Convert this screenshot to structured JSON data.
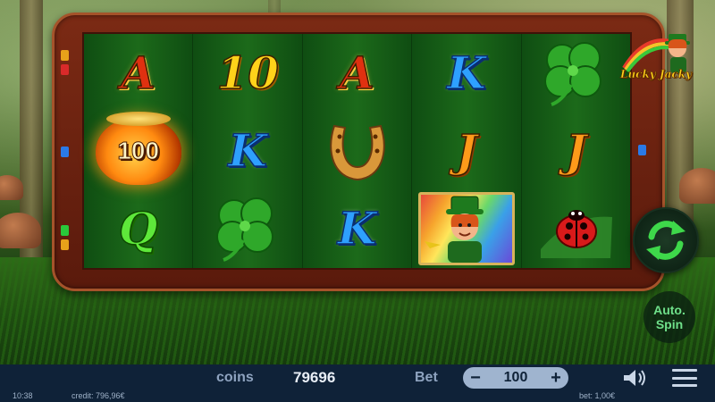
{
  "game": {
    "logo_text": "Lucky Jacky",
    "reels": [
      [
        "A",
        "100",
        "Q"
      ],
      [
        "10",
        "K",
        "clover"
      ],
      [
        "A",
        "horseshoe",
        "K"
      ],
      [
        "K",
        "J",
        "leprechaun"
      ],
      [
        "clover",
        "J",
        "ladybug"
      ]
    ],
    "pot_value": "100",
    "auto_spin_label_1": "Auto.",
    "auto_spin_label_2": "Spin"
  },
  "bottom_bar": {
    "coins_label": "coins",
    "coins_value": "79696",
    "bet_label": "Bet",
    "bet_value": "100",
    "minus_label": "−",
    "plus_label": "+"
  },
  "status": {
    "time": "10:38",
    "credit": "credit: 796,96€",
    "bet": "bet: 1,00€"
  },
  "colors": {
    "bar_bg": "#0f2238",
    "frame": "#7b2a14",
    "reel_green": "#1c6a1a",
    "spin_arrow": "#3ed84a"
  }
}
